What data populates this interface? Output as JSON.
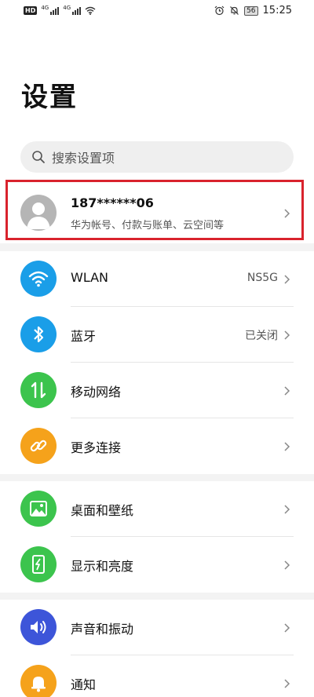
{
  "status_bar": {
    "left_badge": "HD",
    "signal1_label": "4G",
    "signal2_label": "4G",
    "battery": "56",
    "time": "15:25"
  },
  "page": {
    "title": "设置"
  },
  "search": {
    "placeholder": "搜索设置项"
  },
  "account": {
    "name": "187******06",
    "subtitle": "华为帐号、付款与账单、云空间等",
    "highlight_color": "#d9232d"
  },
  "groups": [
    {
      "items": [
        {
          "label": "WLAN",
          "value": "NS5G",
          "icon": "wifi-icon",
          "color": "#1a9ee8"
        },
        {
          "label": "蓝牙",
          "value": "已关闭",
          "icon": "bluetooth-icon",
          "color": "#1a9ee8"
        },
        {
          "label": "移动网络",
          "value": "",
          "icon": "mobile-data-icon",
          "color": "#3cc44d"
        },
        {
          "label": "更多连接",
          "value": "",
          "icon": "link-icon",
          "color": "#f5a21b"
        }
      ]
    },
    {
      "items": [
        {
          "label": "桌面和壁纸",
          "value": "",
          "icon": "wallpaper-icon",
          "color": "#3cc44d"
        },
        {
          "label": "显示和亮度",
          "value": "",
          "icon": "display-icon",
          "color": "#3cc44d"
        }
      ]
    },
    {
      "items": [
        {
          "label": "声音和振动",
          "value": "",
          "icon": "sound-icon",
          "color": "#3d55d9"
        },
        {
          "label": "通知",
          "value": "",
          "icon": "bell-icon",
          "color": "#f5a21b"
        }
      ]
    }
  ]
}
